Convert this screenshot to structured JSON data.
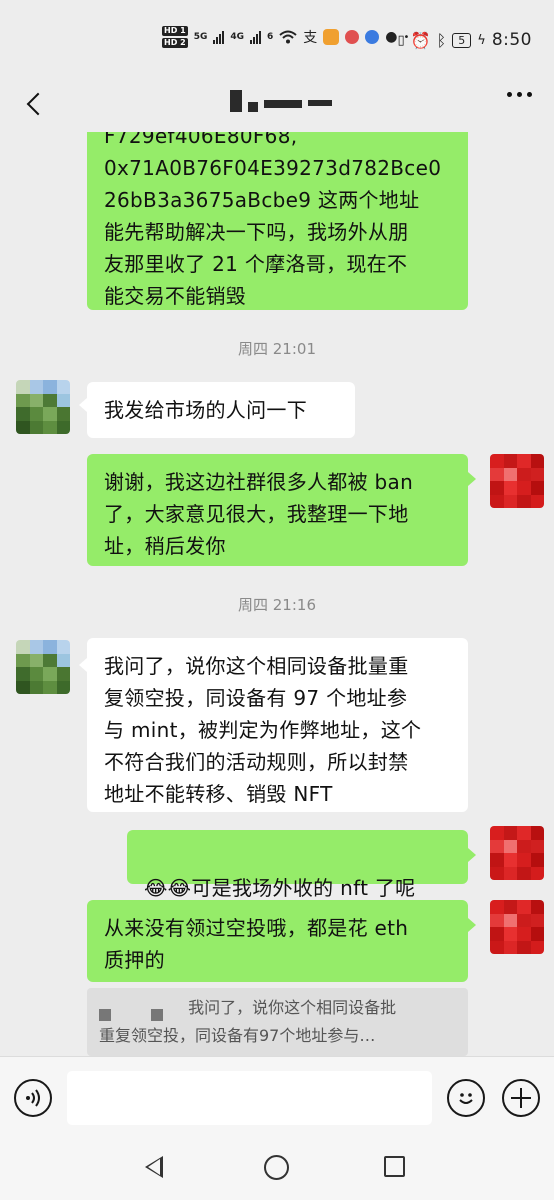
{
  "status_bar": {
    "sim1": "HD 1",
    "sim2": "HD 2",
    "net1": "5G",
    "net2": "4G",
    "wifi_label": "6",
    "battery": "5",
    "time": "8:50"
  },
  "nav": {
    "contact_name_redacted": true
  },
  "messages": [
    {
      "side": "right",
      "text": "F729ef406E80F68,\n0x71A0B76F04E39273d782Bce0\n26bB3a3675aBcbe9 这两个地址\n能先帮助解决一下吗，我场外从朋\n友那里收了 21 个摩洛哥，现在不\n能交易不能销毁"
    },
    {
      "type": "timestamp",
      "text": "周四 21:01"
    },
    {
      "side": "left",
      "text": "我发给市场的人问一下"
    },
    {
      "side": "right",
      "text": "谢谢，我这边社群很多人都被 ban\n了，大家意见很大，我整理一下地\n址，稍后发你"
    },
    {
      "type": "timestamp",
      "text": "周四 21:16"
    },
    {
      "side": "left",
      "text": "我问了，说你这个相同设备批量重\n复领空投，同设备有 97 个地址参\n与 mint，被判定为作弊地址，这个\n不符合我们的活动规则，所以封禁\n地址不能转移、销毁 NFT"
    },
    {
      "side": "right",
      "emoji": "😂😂",
      "text": "可是我场外收的 nft 了呢"
    },
    {
      "side": "right",
      "text": "从来没有领过空投哦，都是花 eth\n质押的"
    }
  ],
  "quote": {
    "line1": "我问了，说你这个相同设备批",
    "line2": "重复领空投，同设备有97个地址参与…"
  },
  "input_bar": {
    "placeholder": ""
  },
  "colors": {
    "outgoing_bubble": "#95ec69",
    "incoming_bubble": "#ffffff",
    "background": "#ededed"
  }
}
